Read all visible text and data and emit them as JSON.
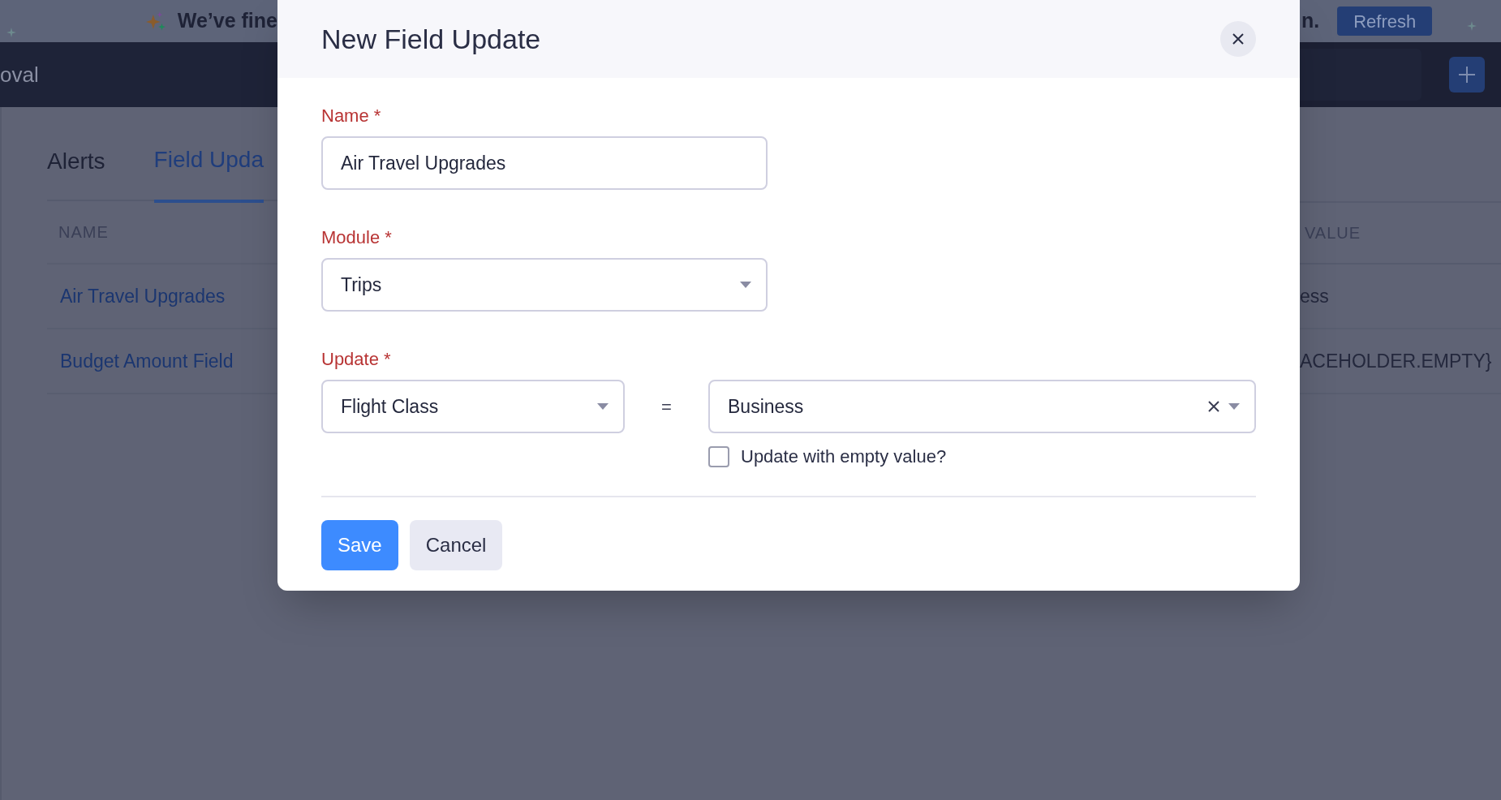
{
  "banner": {
    "message": "We’ve fine",
    "message_end": "n.",
    "refresh_button": "Refresh"
  },
  "nav": {
    "title": "oval"
  },
  "tabs": [
    {
      "label": "Alerts",
      "selected": false
    },
    {
      "label": "Field Upda",
      "selected": true
    }
  ],
  "table": {
    "columns": [
      "NAME",
      "VALUE"
    ],
    "rows": [
      {
        "name": "Air Travel Upgrades",
        "value": "ess"
      },
      {
        "name": "Budget Amount Field",
        "value": "ACEHOLDER.EMPTY}"
      }
    ]
  },
  "dialog": {
    "title": "New Field Update",
    "name": {
      "label": "Name *",
      "value": "Air Travel Upgrades"
    },
    "module": {
      "label": "Module *",
      "value": "Trips"
    },
    "update": {
      "label": "Update *",
      "field": "Flight Class",
      "operator": "=",
      "value": "Business",
      "clearable": true
    },
    "empty_checkbox": {
      "label": "Update with empty value?",
      "checked": false
    },
    "buttons": [
      {
        "label": "Save",
        "kind": "primary"
      },
      {
        "label": "Cancel",
        "kind": "secondary"
      }
    ]
  }
}
